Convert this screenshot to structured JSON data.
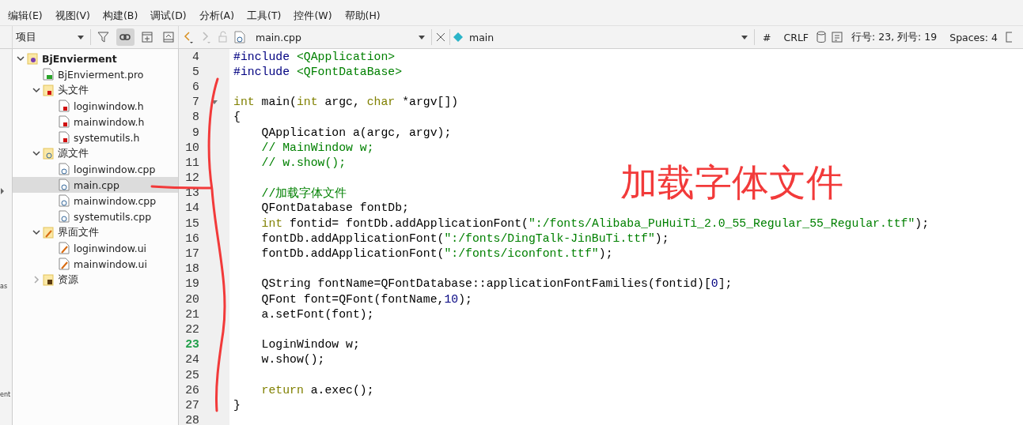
{
  "menu": [
    "编辑(E)",
    "视图(V)",
    "构建(B)",
    "调试(D)",
    "分析(A)",
    "工具(T)",
    "控件(W)",
    "帮助(H)"
  ],
  "side_strip": {
    "fragments": [
      "as",
      "ent"
    ]
  },
  "project_toolbar": {
    "view_select": "项目",
    "link_on": true
  },
  "editor_toolbar": {
    "file_select": "main.cpp",
    "symbol_select": "main",
    "hash": "#",
    "line_ending": "CRLF",
    "position": "行号: 23, 列号: 19",
    "indent": "Spaces: 4"
  },
  "tree": [
    {
      "label": "BjEnvierment",
      "kind": "project",
      "expanded": true,
      "selected": false,
      "children": [
        {
          "label": "BjEnvierment.pro",
          "kind": "pro",
          "selected": false
        },
        {
          "label": "头文件",
          "kind": "folder-h",
          "expanded": true,
          "selected": false,
          "children": [
            {
              "label": "loginwindow.h",
              "kind": "h",
              "selected": false
            },
            {
              "label": "mainwindow.h",
              "kind": "h",
              "selected": false
            },
            {
              "label": "systemutils.h",
              "kind": "h",
              "selected": false
            }
          ]
        },
        {
          "label": "源文件",
          "kind": "folder-cpp",
          "expanded": true,
          "selected": false,
          "children": [
            {
              "label": "loginwindow.cpp",
              "kind": "cpp",
              "selected": false
            },
            {
              "label": "main.cpp",
              "kind": "cpp",
              "selected": true
            },
            {
              "label": "mainwindow.cpp",
              "kind": "cpp",
              "selected": false
            },
            {
              "label": "systemutils.cpp",
              "kind": "cpp",
              "selected": false
            }
          ]
        },
        {
          "label": "界面文件",
          "kind": "folder-ui",
          "expanded": true,
          "selected": false,
          "children": [
            {
              "label": "loginwindow.ui",
              "kind": "ui",
              "selected": false
            },
            {
              "label": "mainwindow.ui",
              "kind": "ui",
              "selected": false
            }
          ]
        },
        {
          "label": "资源",
          "kind": "folder-res",
          "expanded": false,
          "selected": false
        }
      ]
    }
  ],
  "code": {
    "lines": [
      {
        "number": "4",
        "current": false,
        "tokens": [
          {
            "text": "#include",
            "kind": "preproc"
          },
          {
            "text": " <QApplication>",
            "kind": "string"
          }
        ]
      },
      {
        "number": "5",
        "current": false,
        "tokens": [
          {
            "text": "#include",
            "kind": "preproc"
          },
          {
            "text": " <QFontDataBase>",
            "kind": "string"
          }
        ]
      },
      {
        "number": "6",
        "current": false
      },
      {
        "number": "7",
        "current": false,
        "fold": true,
        "tokens": [
          {
            "text": "int",
            "kind": "keyword"
          },
          {
            "text": " main("
          },
          {
            "text": "int",
            "kind": "keyword"
          },
          {
            "text": " argc, "
          },
          {
            "text": "char",
            "kind": "keyword"
          },
          {
            "text": " *argv[])"
          }
        ]
      },
      {
        "number": "8",
        "current": false,
        "tokens": [
          {
            "text": "{"
          }
        ]
      },
      {
        "number": "9",
        "current": false,
        "tokens": [
          {
            "text": "    QApplication a(argc, argv);"
          }
        ]
      },
      {
        "number": "10",
        "current": false,
        "tokens": [
          {
            "text": "    // MainWindow w;",
            "kind": "comment"
          }
        ]
      },
      {
        "number": "11",
        "current": false,
        "tokens": [
          {
            "text": "    // w.show();",
            "kind": "comment"
          }
        ]
      },
      {
        "number": "12",
        "current": false
      },
      {
        "number": "13",
        "current": false,
        "tokens": [
          {
            "text": "    //加载字体文件",
            "kind": "comment"
          }
        ]
      },
      {
        "number": "14",
        "current": false,
        "tokens": [
          {
            "text": "    QFontDatabase fontDb;"
          }
        ]
      },
      {
        "number": "15",
        "current": false,
        "tokens": [
          {
            "text": "    int",
            "kind": "keyword"
          },
          {
            "text": " fontid= fontDb.addApplicationFont("
          },
          {
            "text": "\":/fonts/Alibaba_PuHuiTi_2.0_55_Regular_55_Regular.ttf\"",
            "kind": "string"
          },
          {
            "text": ");"
          }
        ]
      },
      {
        "number": "16",
        "current": false,
        "tokens": [
          {
            "text": "    fontDb.addApplicationFont("
          },
          {
            "text": "\":/fonts/DingTalk-JinBuTi.ttf\"",
            "kind": "string"
          },
          {
            "text": ");"
          }
        ]
      },
      {
        "number": "17",
        "current": false,
        "tokens": [
          {
            "text": "    fontDb.addApplicationFont("
          },
          {
            "text": "\":/fonts/iconfont.ttf\"",
            "kind": "string"
          },
          {
            "text": ");"
          }
        ]
      },
      {
        "number": "18",
        "current": false
      },
      {
        "number": "19",
        "current": false,
        "tokens": [
          {
            "text": "    QString fontName=QFontDatabase::applicationFontFamilies(fontid)["
          },
          {
            "text": "0",
            "kind": "number"
          },
          {
            "text": "];"
          }
        ]
      },
      {
        "number": "20",
        "current": false,
        "tokens": [
          {
            "text": "    QFont font=QFont(fontName,"
          },
          {
            "text": "10",
            "kind": "number"
          },
          {
            "text": ");"
          }
        ]
      },
      {
        "number": "21",
        "current": false,
        "tokens": [
          {
            "text": "    a.setFont(font);"
          }
        ]
      },
      {
        "number": "22",
        "current": false
      },
      {
        "number": "23",
        "current": true,
        "tokens": [
          {
            "text": "    LoginWindow w;"
          }
        ]
      },
      {
        "number": "24",
        "current": false,
        "tokens": [
          {
            "text": "    w.show();"
          }
        ]
      },
      {
        "number": "25",
        "current": false
      },
      {
        "number": "26",
        "current": false,
        "tokens": [
          {
            "text": "    return",
            "kind": "keyword"
          },
          {
            "text": " a.exec();"
          }
        ]
      },
      {
        "number": "27",
        "current": false,
        "tokens": [
          {
            "text": "}"
          }
        ]
      },
      {
        "number": "28",
        "current": false
      }
    ]
  },
  "annotation": {
    "text": "加载字体文件"
  }
}
